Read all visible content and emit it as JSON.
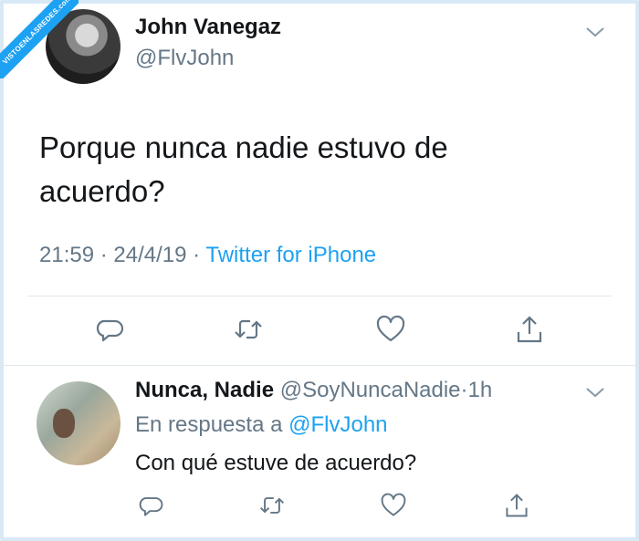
{
  "watermark": {
    "text": "VISTOENLASREDES.com"
  },
  "tweet": {
    "author_name": "John Vanegaz",
    "author_handle": "@FlvJohn",
    "text_line1": "Porque nunca nadie estuvo de",
    "text_line2": "acuerdo?",
    "time": "21:59",
    "date": "24/4/19",
    "separator": "·",
    "source": "Twitter for iPhone"
  },
  "reply": {
    "author_name": "Nunca, Nadie",
    "author_handle": "@SoyNuncaNadie",
    "separator": "·",
    "age": "1h",
    "in_reply_prefix": "En respuesta a",
    "in_reply_mention": "@FlvJohn",
    "text": "Con qué estuve de acuerdo?"
  },
  "icons": {
    "reply": "reply-icon",
    "retweet": "retweet-icon",
    "like": "heart-icon",
    "share": "share-icon",
    "menu": "chevron-down-icon"
  },
  "colors": {
    "accent": "#1da1f2",
    "secondary_text": "#657786",
    "primary_text": "#14171a",
    "divider": "#e1e8ed",
    "frame": "#d9e8f5"
  }
}
